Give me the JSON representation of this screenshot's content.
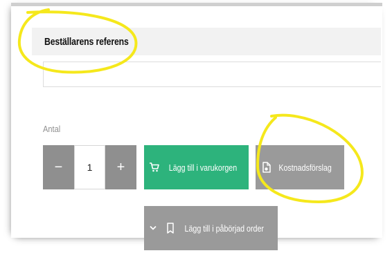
{
  "reference": {
    "label": "Beställarens referens",
    "value": "",
    "placeholder": ""
  },
  "quantity": {
    "label": "Antal",
    "value": "1",
    "minus_label": "−",
    "plus_label": "+"
  },
  "buttons": {
    "add_to_cart": "Lägg till i varukorgen",
    "quote": "Kostnadsförslag",
    "add_to_order": "Lägg till i påbörjad order"
  },
  "icons": {
    "cart": "cart-icon",
    "quote": "document-icon",
    "order": "bookmark-icon",
    "chevron": "chevron-down-icon"
  },
  "colors": {
    "primary_green": "#2db37c",
    "gray_button": "#9a9a9a",
    "stepper_gray": "#8f8f8f",
    "highlight_yellow": "#f5e81c"
  }
}
